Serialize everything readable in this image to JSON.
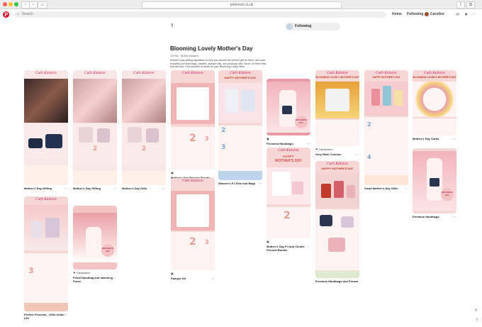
{
  "browser": {
    "url": "pinterest.co.uk"
  },
  "header": {
    "search_placeholder": "Search",
    "nav_home": "Home",
    "nav_following": "Following",
    "user_name": "Caroline",
    "logo": "P"
  },
  "board": {
    "title": "Blooming Lovely Mother's Day",
    "meta": "15 Pins · 58,451 followers",
    "description": "Mother's Day gifting inspiration to help you choose the perfect gift for Mum. We have beautiful premium bags, candles, pamper kits, and products with \"Mum\" on them that she will love. Find bundles of items for your Blooming Lovely Mum.",
    "follow_label": "Following"
  },
  "brand_mark": "Cath Kidston",
  "pin_text": {
    "happy": "HAPPY",
    "mothers_day": "MOTHER'S DAY",
    "mothers_day_badge": "MOTHER'S DAY",
    "happy_mothers_day": "HAPPY MOTHER'S DAY",
    "blooming_lovely_mothers_day": "BLOOMING LOVELY MOTHER'S DAY",
    "cathkidston_handle": "Cathkidston"
  },
  "pins": {
    "p1": {
      "caption": "Mother's Day Gifting"
    },
    "p2": {
      "caption": "Mother's Day Gifting"
    },
    "p3": {
      "caption": "Mother's Day Gifts"
    },
    "p4": {
      "caption": "Mother's Day Present Bundle"
    },
    "p5": {
      "caption": "Women's PJ Sets and Bags"
    },
    "p6": {
      "caption": "Premium Handbags"
    },
    "p7": {
      "caption": "Grey Mum Cushion",
      "source": "Cathkidston"
    },
    "p8": {
      "caption": "Small Mother's Day Gifts"
    },
    "p9": {
      "caption": "Mother's Day Cards"
    },
    "p10": {
      "caption": "Perfect Presents - Gifts Under £30"
    },
    "p11": {
      "caption": "Floral Handbag and matching Purse",
      "source": "Cathkidston"
    },
    "p12": {
      "caption": "Pamper Kit"
    },
    "p13": {
      "caption": "Mother's Day PJ and Candle Present Bundle"
    },
    "p14": {
      "caption": "Premium Handbags and Purses"
    },
    "p15": {
      "caption": "Premium Handbags"
    }
  },
  "more_icon": "···",
  "side_help": "?",
  "colors": {
    "pinterest_red": "#e60023",
    "pink": "#f4c2c2",
    "brand_pink": "#c2185b"
  }
}
